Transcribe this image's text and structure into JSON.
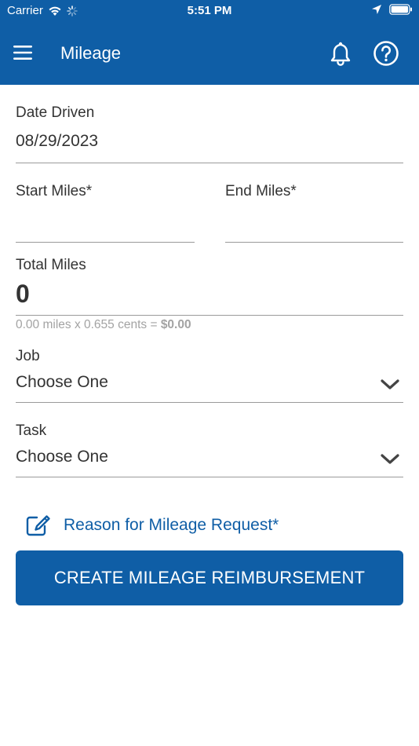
{
  "status_bar": {
    "carrier": "Carrier",
    "time": "5:51 PM",
    "icons": [
      "wifi-icon",
      "loading-spinner-icon",
      "location-arrow-icon",
      "battery-icon"
    ]
  },
  "header": {
    "title": "Mileage",
    "icons": [
      "hamburger-menu-icon",
      "bell-icon",
      "help-icon"
    ],
    "background_color": "#0f5ea6"
  },
  "form": {
    "date_driven": {
      "label": "Date Driven",
      "value": "08/29/2023"
    },
    "start_miles": {
      "label": "Start Miles*",
      "value": ""
    },
    "end_miles": {
      "label": "End Miles*",
      "value": ""
    },
    "total_miles": {
      "label": "Total Miles",
      "value": "0",
      "calc_prefix": "0.00 miles x 0.655 cents = ",
      "calc_total": "$0.00"
    },
    "job": {
      "label": "Job",
      "value": "Choose One"
    },
    "task": {
      "label": "Task",
      "value": "Choose One"
    },
    "reason": {
      "label": "Reason for Mileage Request*",
      "icon": "edit-icon"
    }
  },
  "actions": {
    "create_label": "CREATE MILEAGE REIMBURSEMENT"
  },
  "colors": {
    "primary": "#0f5ea6",
    "text": "#333333",
    "muted": "#a3a3a3"
  }
}
